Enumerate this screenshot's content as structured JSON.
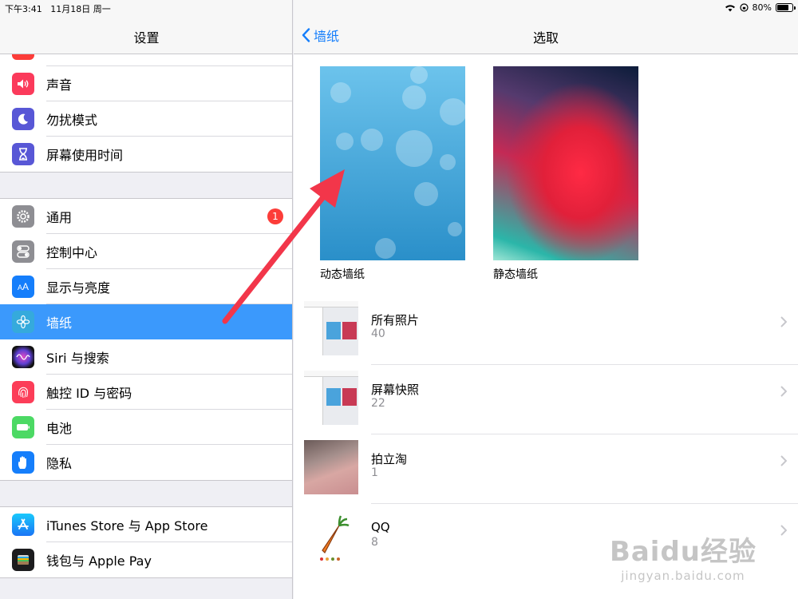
{
  "status_bar": {
    "time": "下午3:41",
    "date": "11月18日 周一",
    "battery": "80%"
  },
  "settings": {
    "title": "设置",
    "group1": [
      {
        "label": "声音",
        "icon": "speaker-icon",
        "color": "#fb3a5b"
      },
      {
        "label": "勿扰模式",
        "icon": "moon-icon",
        "color": "#5857d6"
      },
      {
        "label": "屏幕使用时间",
        "icon": "hourglass-icon",
        "color": "#5857d6"
      }
    ],
    "group2": [
      {
        "label": "通用",
        "icon": "gear-icon",
        "color": "#8e8e93",
        "badge": "1"
      },
      {
        "label": "控制中心",
        "icon": "toggles-icon",
        "color": "#8e8e93"
      },
      {
        "label": "显示与亮度",
        "icon": "text-size-icon",
        "color": "#157efb"
      },
      {
        "label": "墙纸",
        "icon": "flower-icon",
        "color": "#35aadc",
        "selected": true
      },
      {
        "label": "Siri 与搜索",
        "icon": "siri-icon",
        "color": "#222222"
      },
      {
        "label": "触控 ID 与密码",
        "icon": "fingerprint-icon",
        "color": "#fc3d58"
      },
      {
        "label": "电池",
        "icon": "battery-icon",
        "color": "#4cd964"
      },
      {
        "label": "隐私",
        "icon": "hand-icon",
        "color": "#157efb"
      }
    ],
    "group3": [
      {
        "label": "iTunes Store 与 App Store",
        "icon": "app-store-icon",
        "color": "#1d8cf8"
      },
      {
        "label": "钱包与 Apple Pay",
        "icon": "wallet-icon",
        "color": "#1c1c1e"
      }
    ]
  },
  "detail": {
    "back_label": "墙纸",
    "title": "选取",
    "dynamic_label": "动态墙纸",
    "still_label": "静态墙纸",
    "albums": [
      {
        "name": "所有照片",
        "count": "40"
      },
      {
        "name": "屏幕快照",
        "count": "22"
      },
      {
        "name": "拍立淘",
        "count": "1"
      },
      {
        "name": "QQ",
        "count": "8"
      }
    ]
  },
  "watermark": {
    "logo": "Baidu经验",
    "url": "jingyan.baidu.com"
  },
  "colors": {
    "accent": "#157efb",
    "selected_row": "#3b99fc",
    "badge": "#fc3d39",
    "arrow": "#f2364a"
  }
}
